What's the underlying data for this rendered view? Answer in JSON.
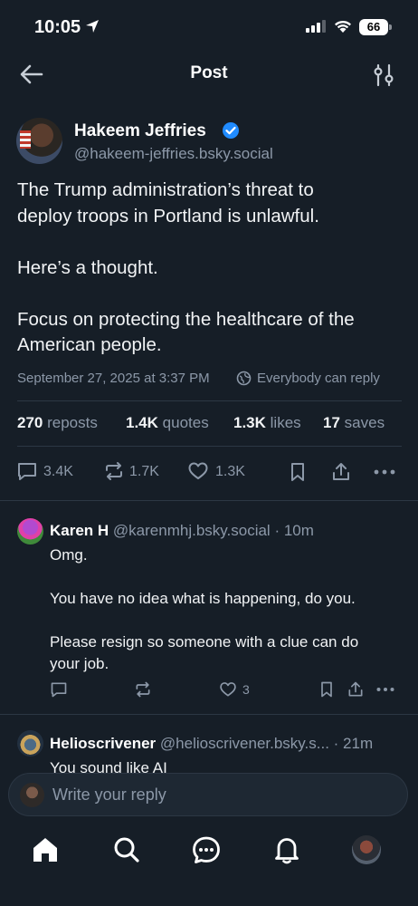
{
  "status_bar": {
    "time": "10:05",
    "battery": "66"
  },
  "nav": {
    "title": "Post",
    "back_icon": "arrow-left-icon",
    "filter_icon": "sliders-icon"
  },
  "post": {
    "author_name": "Hakeem Jeffries",
    "author_handle": "@hakeem-jeffries.bsky.social",
    "verified_color": "#208bfe",
    "text_lines": [
      "The Trump administration’s threat to",
      "deploy troops in Portland is unlawful.",
      "",
      "Here’s a thought.",
      "",
      "Focus on protecting the healthcare of the",
      "American people."
    ],
    "date": "September 27, 2025 at 3:37 PM",
    "reply_setting": "Everybody can reply",
    "stats": {
      "reposts_count": "270",
      "reposts_label": "reposts",
      "quotes_count": "1.4K",
      "quotes_label": "quotes",
      "likes_count": "1.3K",
      "likes_label": "likes",
      "saves_count": "17",
      "saves_label": "saves"
    },
    "actions": {
      "replies": "3.4K",
      "reposts": "1.7K",
      "likes": "1.3K"
    }
  },
  "replies": [
    {
      "name": "Karen H",
      "handle": "@karenmhj.bsky.social",
      "time": "· 10m",
      "lines": [
        "Omg.",
        "",
        "You have no idea what is happening, do you.",
        "",
        "Please resign so someone with a clue can do",
        "your job."
      ],
      "likes": "3"
    },
    {
      "name": "Helioscrivener",
      "handle": "@helioscrivener.bsky.s...",
      "time": "· 21m",
      "lines": [
        "You sound like AI"
      ]
    }
  ],
  "compose": {
    "placeholder": "Write your reply"
  },
  "colors": {
    "background": "#161e27",
    "muted": "#8c98a8",
    "accent": "#208bfe"
  }
}
